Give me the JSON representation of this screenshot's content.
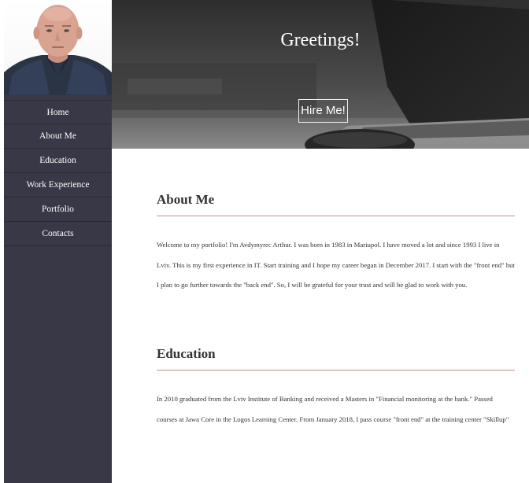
{
  "sidebar": {
    "nav": [
      {
        "label": "Home"
      },
      {
        "label": "About Me"
      },
      {
        "label": "Education"
      },
      {
        "label": "Work Experience"
      },
      {
        "label": "Portfolio"
      },
      {
        "label": "Contacts"
      }
    ]
  },
  "hero": {
    "title": "Greetings!",
    "button_label": "Hire Me!"
  },
  "sections": {
    "about": {
      "title": "About Me",
      "text": "Welcome to my portfolio! I'm Avdymyrec Arthur. I was born in 1983 in Mariupol. I have moved a lot and since 1993 I live in Lviv. This is my first experience in IT. Start training and I hope my career began in December 2017. I start with the \"front end\" but I plan to go further towards the \"back end\". So, I will be grateful for your trust and will be glad to work with you."
    },
    "education": {
      "title": "Education",
      "text": "In 2010 graduated from the Lviv Institute of Banking and received a Masters in \"Financial monitoring at the bank.\" Passed courses at Jawa Core in the Logos Learning Center. From January 2018, I pass course \"front end\" at the training center \"Skillup\""
    }
  },
  "colors": {
    "sidebar_bg": "#393846",
    "section_rule": "#c98a8a",
    "text": "#333333"
  }
}
